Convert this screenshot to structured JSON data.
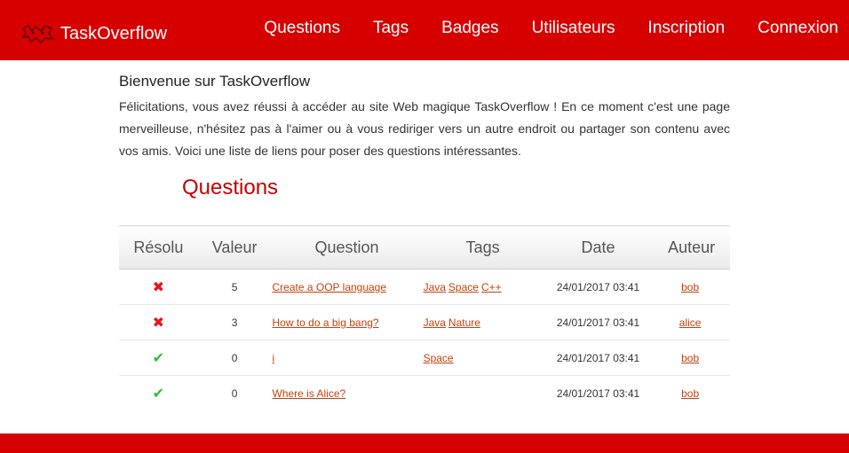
{
  "brand": {
    "name": "TaskOverflow"
  },
  "nav": [
    {
      "label": "Questions"
    },
    {
      "label": "Tags"
    },
    {
      "label": "Badges"
    },
    {
      "label": "Utilisateurs"
    },
    {
      "label": "Inscription"
    },
    {
      "label": "Connexion"
    }
  ],
  "welcome": {
    "title": "Bienvenue sur TaskOverflow",
    "text": "Félicitations, vous avez réussi à accéder au site Web magique TaskOverflow ! En ce moment c'est une page merveilleuse, n'hésitez pas à l'aimer ou à vous rediriger vers un autre endroit ou partager son contenu avec vos amis. Voici une liste de liens pour poser des questions intéressantes."
  },
  "section": {
    "title": "Questions"
  },
  "table": {
    "headers": [
      "Résolu",
      "Valeur",
      "Question",
      "Tags",
      "Date",
      "Auteur"
    ],
    "rows": [
      {
        "resolved": false,
        "resolved_glyph": "✖",
        "value": "5",
        "question": "Create a OOP language",
        "tags": [
          "Java",
          "Space",
          "C++"
        ],
        "date": "24/01/2017 03:41",
        "author": "bob"
      },
      {
        "resolved": false,
        "resolved_glyph": "✖",
        "value": "3",
        "question": "How to do a big bang?",
        "tags": [
          "Java",
          "Nature"
        ],
        "date": "24/01/2017 03:41",
        "author": "alice"
      },
      {
        "resolved": true,
        "resolved_glyph": "✔",
        "value": "0",
        "question": "i",
        "tags": [
          "Space"
        ],
        "date": "24/01/2017 03:41",
        "author": "bob"
      },
      {
        "resolved": true,
        "resolved_glyph": "✔",
        "value": "0",
        "question": "Where is Alice?",
        "tags": [],
        "date": "24/01/2017 03:41",
        "author": "bob"
      }
    ]
  },
  "colors": {
    "brand_red": "#d60000",
    "title_red": "#c40000",
    "link": "#c2410c",
    "resolved_no": "#e8131b",
    "resolved_yes": "#2fbf2f"
  },
  "icons": {
    "brand": "taskoverflow-logo-icon",
    "unresolved": "cross-icon",
    "resolved": "check-icon"
  }
}
